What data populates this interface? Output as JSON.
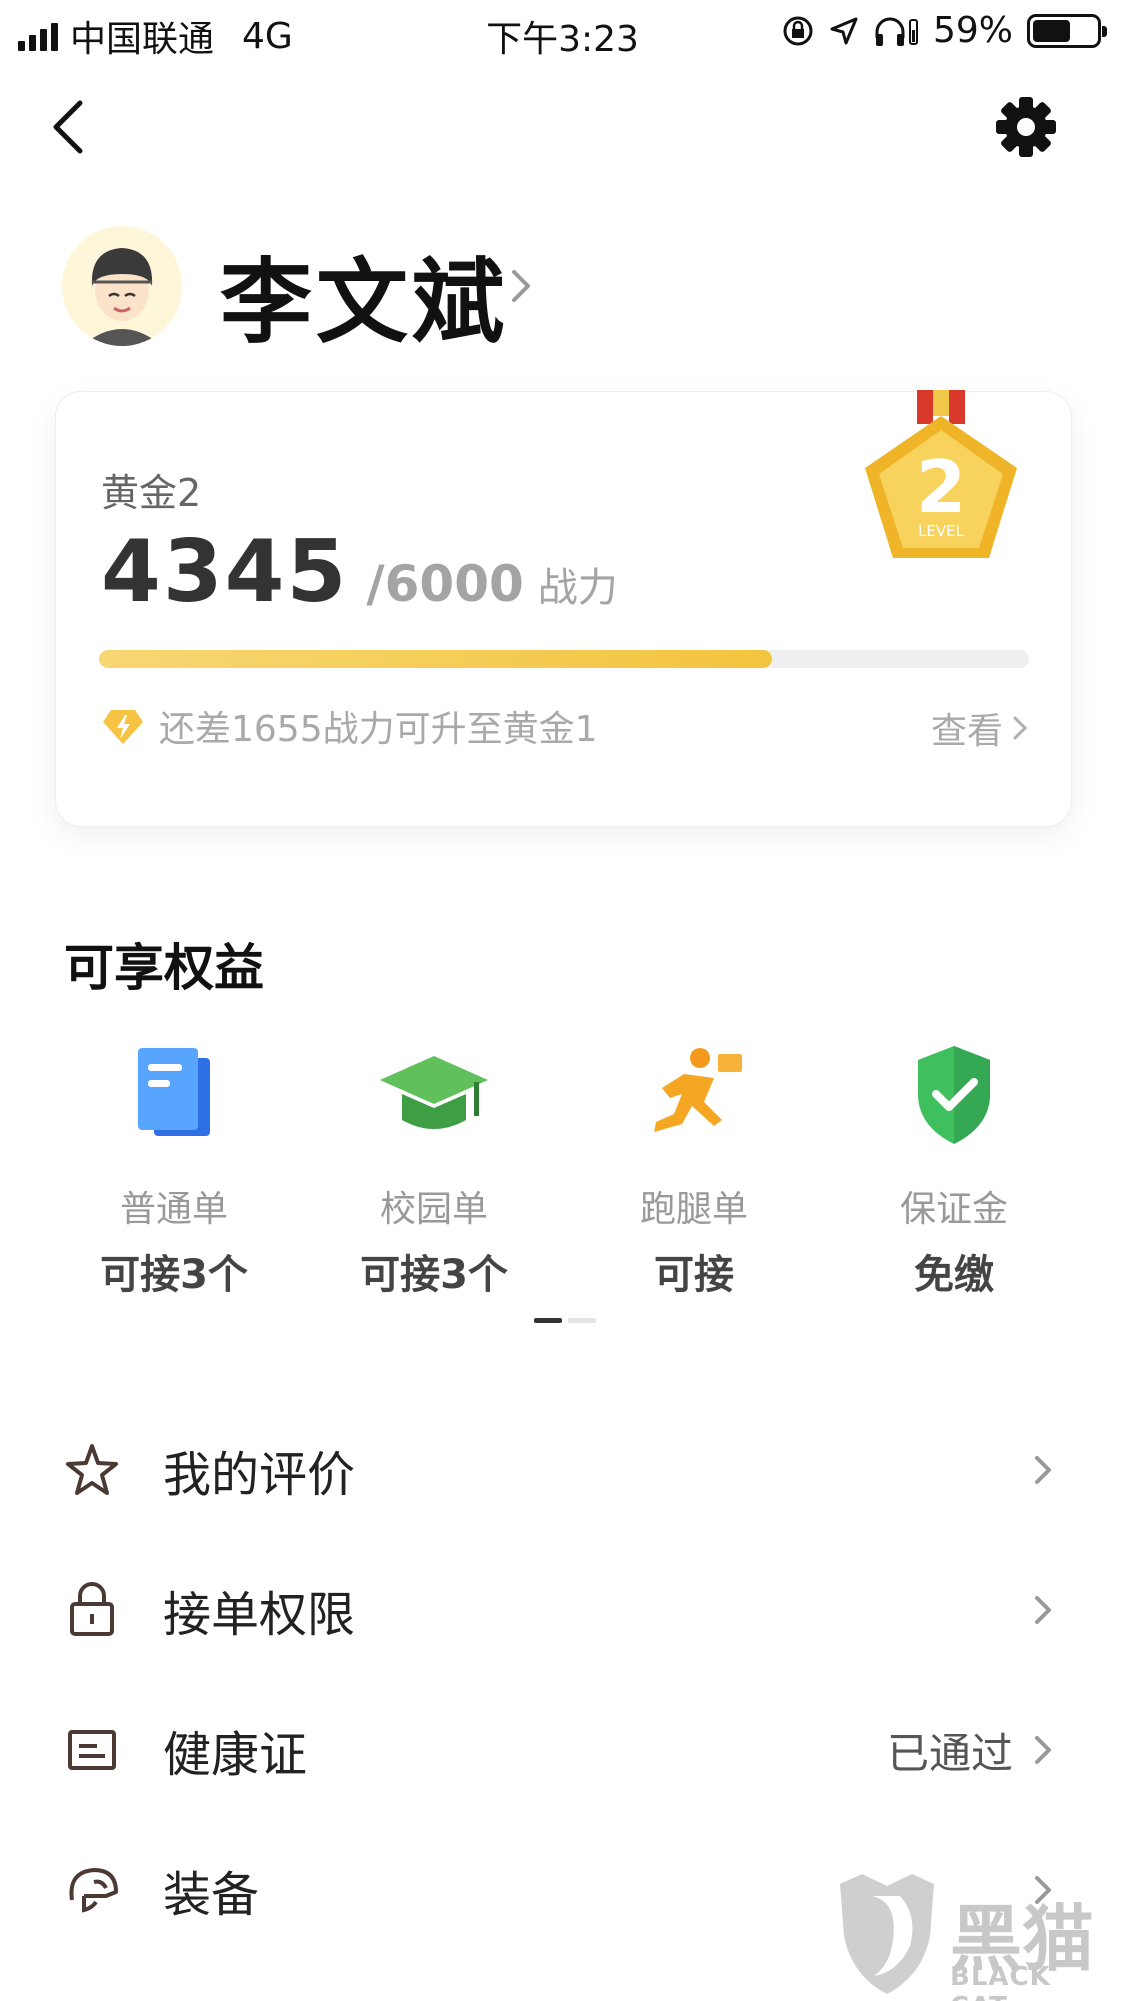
{
  "status_bar": {
    "carrier": "中国联通",
    "network": "4G",
    "time": "下午3:23",
    "battery": "59%",
    "battery_level": 0.59
  },
  "nav": {
    "back_icon": "chevron-left-icon",
    "settings_icon": "gear-icon"
  },
  "profile": {
    "name": "李文斌"
  },
  "level_card": {
    "level_name": "黄金2",
    "score": "4345",
    "total": "/6000",
    "unit": "战力",
    "progress": 0.724,
    "tip": "还差1655战力可升至黄金1",
    "view_label": "查看",
    "medal_number": "2",
    "medal_text": "LEVEL",
    "accent_color": "#f3c43e"
  },
  "benefits": {
    "title": "可享权益",
    "items": [
      {
        "icon": "document-icon",
        "title": "普通单",
        "value": "可接3个"
      },
      {
        "icon": "graduation-cap-icon",
        "title": "校园单",
        "value": "可接3个"
      },
      {
        "icon": "runner-icon",
        "title": "跑腿单",
        "value": "可接"
      },
      {
        "icon": "shield-check-icon",
        "title": "保证金",
        "value": "免缴"
      }
    ]
  },
  "menu": [
    {
      "icon": "star-icon",
      "label": "我的评价",
      "value": ""
    },
    {
      "icon": "lock-icon",
      "label": "接单权限",
      "value": ""
    },
    {
      "icon": "id-card-icon",
      "label": "健康证",
      "value": "已通过"
    },
    {
      "icon": "helmet-icon",
      "label": "装备",
      "value": ""
    }
  ],
  "watermark": {
    "text": "黑猫",
    "sub": "BLACK CAT"
  }
}
